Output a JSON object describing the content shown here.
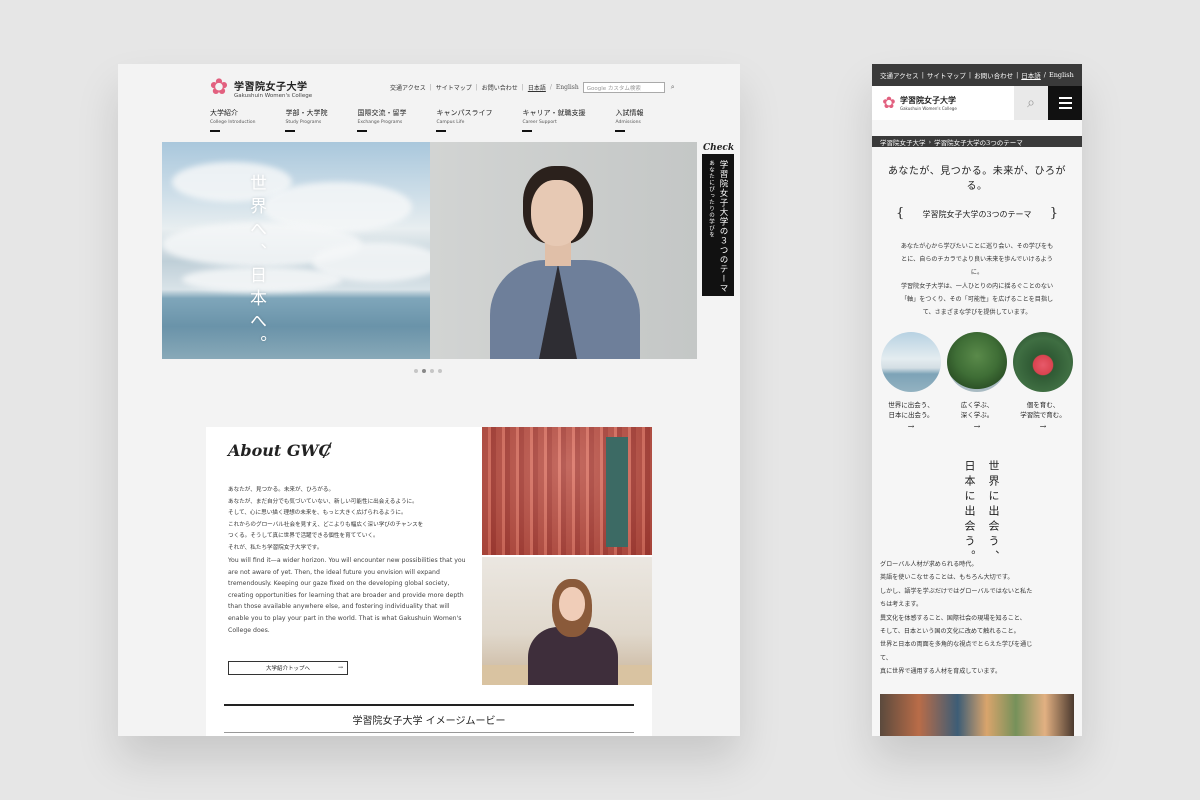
{
  "desktop": {
    "logo": {
      "name_jp": "学習院女子大学",
      "name_en": "Gakushuin Women's College"
    },
    "util": {
      "links": [
        "交通アクセス",
        "サイトマップ",
        "お問い合わせ"
      ],
      "lang_jp": "日本語",
      "lang_en": "English",
      "search_placeholder": "Google カスタム検索"
    },
    "nav": [
      {
        "jp": "大学紹介",
        "en": "College Introduction"
      },
      {
        "jp": "学部・大学院",
        "en": "Study Programs"
      },
      {
        "jp": "国際交流・留学",
        "en": "Exchange Programs"
      },
      {
        "jp": "キャンパスライフ",
        "en": "Campus Life"
      },
      {
        "jp": "キャリア・就職支援",
        "en": "Career Support"
      },
      {
        "jp": "入試情報",
        "en": "Admissions"
      }
    ],
    "hero": {
      "copy": "世界へ、日本へ。"
    },
    "side_tab": {
      "check": "Check",
      "main": "学習院女子大学の３つのテーマ",
      "sub": "あなたにぴったりの学びを"
    },
    "slider": {
      "count": 4,
      "active_index": 1
    },
    "about": {
      "title": "About GWC",
      "slash": "/",
      "jp_lines": [
        "あなたが、見つかる。未来が、ひろがる。",
        "あなたが、まだ自分でも気づいていない、新しい可能性に出会えるように。",
        "そして、心に思い描く理想の未来を、もっと大きく広げられるように。",
        "これからのグローバル社会を見すえ、どこよりも幅広く深い学びのチャンスを",
        "つくる。そうして真に世界で活躍できる個性を育てていく。",
        "それが、私たち学習院女子大学です。"
      ],
      "en_text": "You will find it—a wider horizon. You will encounter new possibilities that you are not aware of yet. Then, the ideal future you envision will expand tremendously. Keeping our gaze fixed on the developing global society, creating opportunities for learning that are broader and provide more depth than those available anywhere else, and fostering individuality that will enable you to play your part in the world. That is what Gakushuin Women's College does.",
      "button": "大学紹介トップへ",
      "button_arrow": "→"
    },
    "movie_title": "学習院女子大学 イメージムービー"
  },
  "mobile": {
    "top_links": [
      "交通アクセス",
      "サイトマップ",
      "お問い合わせ"
    ],
    "lang_jp": "日本語",
    "lang_en": "English",
    "logo": {
      "name_jp": "学習院女子大学",
      "name_en": "Gakushuin Women's College"
    },
    "breadcrumb": [
      "学習院女子大学",
      "学習院女子大学の3つのテーマ"
    ],
    "catch_line1": "あなたが、見つかる。未来が、ひろが",
    "catch_line2": "る。",
    "theme_title": "学習院女子大学の3つのテーマ",
    "theme_lb": "{",
    "theme_rb": "}",
    "body_lines": [
      "あなたが心から学びたいことに巡り会い、その学びをも",
      "とに、自らのチカラでより良い未来を歩んでいけるよう",
      "に。",
      "学習院女子大学は、一人ひとりの内に揺るぐことのない",
      "「軸」をつくり、その「可能性」を広げることを目指し",
      "て、さまざまな学びを提供しています。"
    ],
    "circles": [
      {
        "l1": "世界に出会う、",
        "l2": "日本に出会う。",
        "arrow": "→"
      },
      {
        "l1": "広く学ぶ、",
        "l2": "深く学ぶ。",
        "arrow": "→"
      },
      {
        "l1": "個を育む、",
        "l2": "学習院で育む。",
        "arrow": "→"
      }
    ],
    "vertical": [
      "世界に出会う、",
      "日本に出会う。"
    ],
    "para": [
      "グローバル人材が求められる時代。",
      "英語を使いこなせることは、もちろん大切です。",
      "しかし、語学を学ぶだけではグローバルではないと私た",
      "ちは考えます。",
      "異文化を体感すること、国際社会の現場を知ること、",
      "そして、日本という国の文化に改めて触れること。",
      "世界と日本の両面を多角的な視点でとらえた学びを通じ",
      "て、",
      "真に世界で通用する人材を育成しています。"
    ]
  }
}
